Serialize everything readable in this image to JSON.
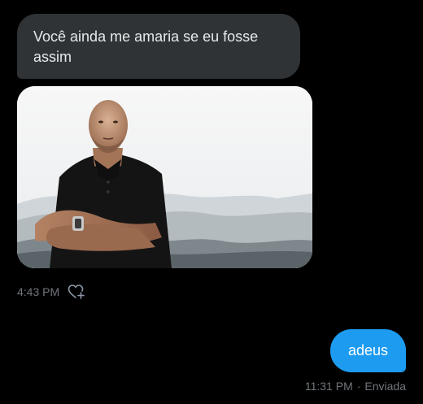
{
  "conversation": {
    "received": {
      "text": "Você ainda me amaria se eu fosse assim",
      "time": "4:43 PM",
      "reaction_icon": "heart-plus-icon",
      "image_description_icon": "photo-attachment"
    },
    "sent": {
      "text": "adeus",
      "time": "11:31 PM",
      "separator": "·",
      "status": "Enviada"
    }
  },
  "colors": {
    "background": "#000000",
    "received_bubble": "#2f3336",
    "sent_bubble": "#1d9bf0",
    "meta_text": "#71767b"
  }
}
